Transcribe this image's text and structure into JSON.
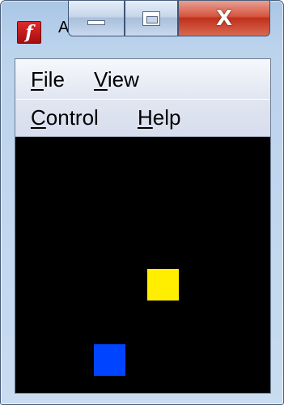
{
  "window": {
    "title": "A",
    "icon": "flash-player-icon",
    "caption_buttons": {
      "minimize_icon": "minimize-icon",
      "maximize_icon": "maximize-icon",
      "close_glyph": "X"
    }
  },
  "menubar": {
    "items": [
      {
        "access_key": "F",
        "rest": "ile"
      },
      {
        "access_key": "V",
        "rest": "iew"
      },
      {
        "access_key": "C",
        "rest": "ontrol"
      },
      {
        "access_key": "H",
        "rest": "elp"
      }
    ]
  },
  "stage": {
    "background": "#000000",
    "objects": [
      {
        "name": "yellow-square",
        "color": "#ffee00"
      },
      {
        "name": "blue-square",
        "color": "#0044ff"
      }
    ]
  },
  "flash_icon_glyph": "f"
}
